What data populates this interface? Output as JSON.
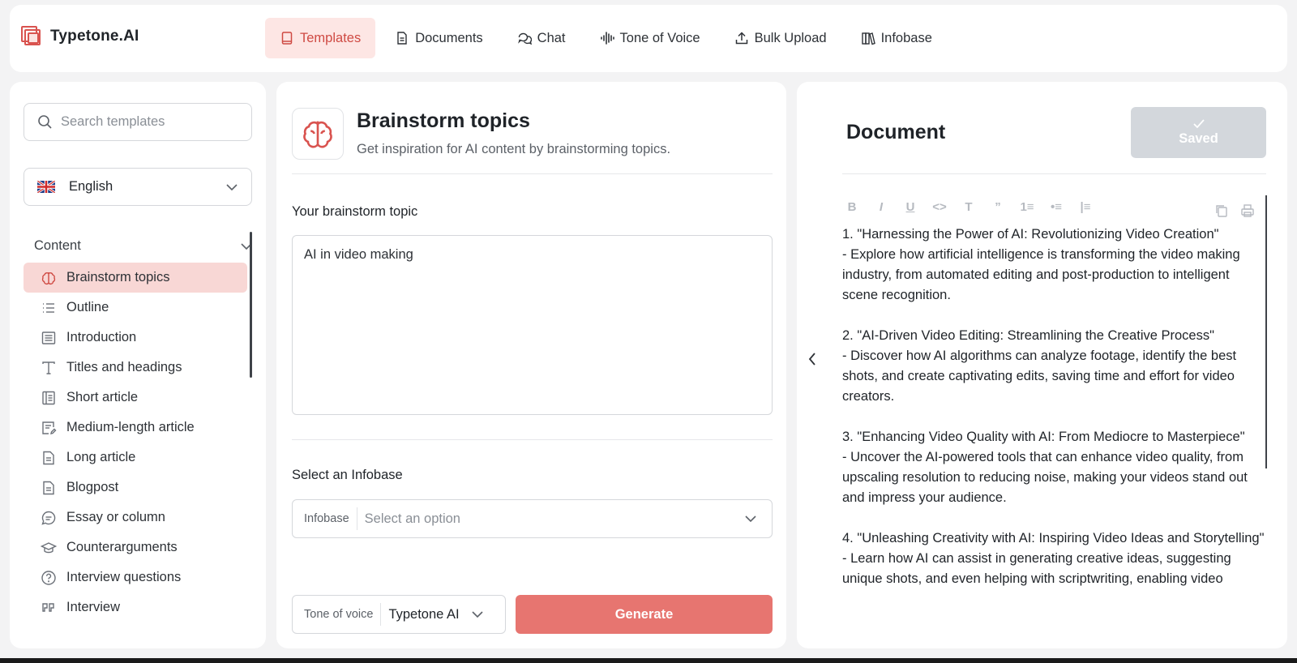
{
  "app": {
    "name": "Typetone.AI"
  },
  "nav": [
    {
      "label": "Templates",
      "icon": "document-icon",
      "active": true
    },
    {
      "label": "Documents",
      "icon": "file-text-icon",
      "active": false
    },
    {
      "label": "Chat",
      "icon": "chat-icon",
      "active": false
    },
    {
      "label": "Tone of Voice",
      "icon": "waveform-icon",
      "active": false
    },
    {
      "label": "Bulk Upload",
      "icon": "upload-icon",
      "active": false
    },
    {
      "label": "Infobase",
      "icon": "books-icon",
      "active": false
    }
  ],
  "sidebar": {
    "search_placeholder": "Search templates",
    "language": "English",
    "section": "Content",
    "items": [
      {
        "label": "Brainstorm topics",
        "icon": "brain-icon",
        "active": true
      },
      {
        "label": "Outline",
        "icon": "list-icon"
      },
      {
        "label": "Introduction",
        "icon": "paragraph-icon"
      },
      {
        "label": "Titles and headings",
        "icon": "type-icon"
      },
      {
        "label": "Short article",
        "icon": "article-icon"
      },
      {
        "label": "Medium-length article",
        "icon": "article-edit-icon"
      },
      {
        "label": "Long article",
        "icon": "file-icon"
      },
      {
        "label": "Blogpost",
        "icon": "file-icon"
      },
      {
        "label": "Essay or column",
        "icon": "message-circle-icon"
      },
      {
        "label": "Counterarguments",
        "icon": "graduation-cap-icon"
      },
      {
        "label": "Interview questions",
        "icon": "question-circle-icon"
      },
      {
        "label": "Interview",
        "icon": "quote-icon"
      }
    ]
  },
  "form": {
    "title": "Brainstorm topics",
    "subtitle": "Get inspiration for AI content by brainstorming topics.",
    "topic_label": "Your brainstorm topic",
    "topic_value": "AI in video making",
    "infobase_label": "Select an Infobase",
    "infobase_tag": "Infobase",
    "infobase_placeholder": "Select an option",
    "tone_tag": "Tone of voice",
    "tone_value": "Typetone AI",
    "generate_label": "Generate"
  },
  "document": {
    "title": "Document",
    "saved_label": "Saved",
    "toolbar": [
      "B",
      "I",
      "U",
      "<>",
      "T",
      "”",
      "1≡",
      "•≡",
      "|≡"
    ],
    "paragraphs": [
      "1. \"Harnessing the Power of AI: Revolutionizing Video Creation\"\n- Explore how artificial intelligence is transforming the video making industry, from automated editing and post-production to intelligent scene recognition.",
      "2. \"AI-Driven Video Editing: Streamlining the Creative Process\"\n- Discover how AI algorithms can analyze footage, identify the best shots, and create captivating edits, saving time and effort for video creators.",
      "3. \"Enhancing Video Quality with AI: From Mediocre to Masterpiece\"\n- Uncover the AI-powered tools that can enhance video quality, from upscaling resolution to reducing noise, making your videos stand out and impress your audience.",
      "4. \"Unleashing Creativity with AI: Inspiring Video Ideas and Storytelling\"\n- Learn how AI can assist in generating creative ideas, suggesting unique shots, and even helping with scriptwriting, enabling video"
    ]
  },
  "colors": {
    "accent": "#e77570",
    "accent_light": "#f8d7d5",
    "nav_active_bg": "#fde6e4",
    "saved_bg": "#d3d7dc"
  }
}
